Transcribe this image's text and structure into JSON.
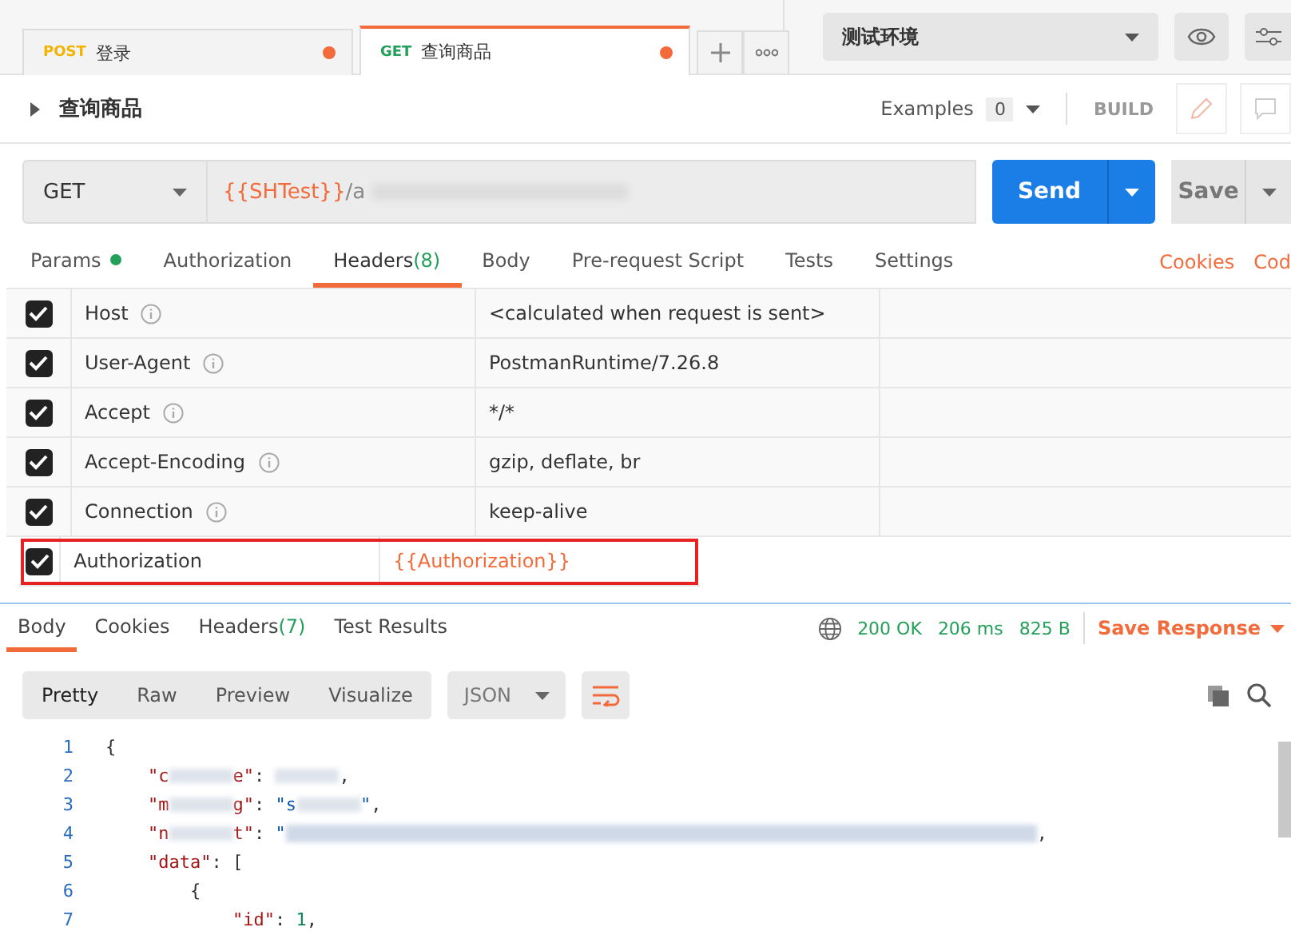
{
  "request_tabs": [
    {
      "method": "POST",
      "name": "登录",
      "selected": false,
      "unsaved": true
    },
    {
      "method": "GET",
      "name": "查询商品",
      "selected": true,
      "unsaved": true
    }
  ],
  "environment": {
    "value": "测试环境"
  },
  "request": {
    "title": "查询商品",
    "examples_label": "Examples",
    "examples_count": "0",
    "build_label": "BUILD",
    "method": "GET",
    "url_variable": "{{SHTest}}",
    "url_rest": "/a",
    "send_label": "Send",
    "save_label": "Save"
  },
  "request_tabs_bar": [
    {
      "label": "Params",
      "dot": true,
      "selected": false
    },
    {
      "label": "Authorization",
      "dot": false,
      "selected": false
    },
    {
      "label": "Headers",
      "dot": false,
      "count": "(8)",
      "selected": true
    },
    {
      "label": "Body",
      "dot": false,
      "selected": false
    },
    {
      "label": "Pre-request Script",
      "dot": false,
      "selected": false
    },
    {
      "label": "Tests",
      "dot": false,
      "selected": false
    },
    {
      "label": "Settings",
      "dot": false,
      "selected": false
    }
  ],
  "links": [
    "Cookies",
    "Cod"
  ],
  "headers": [
    {
      "checked": true,
      "key": "Host",
      "info": true,
      "value": "<calculated when request is sent>",
      "variable": false,
      "highlighted": false
    },
    {
      "checked": true,
      "key": "User-Agent",
      "info": true,
      "value": "PostmanRuntime/7.26.8",
      "variable": false,
      "highlighted": false
    },
    {
      "checked": true,
      "key": "Accept",
      "info": true,
      "value": "*/*",
      "variable": false,
      "highlighted": false
    },
    {
      "checked": true,
      "key": "Accept-Encoding",
      "info": true,
      "value": "gzip, deflate, br",
      "variable": false,
      "highlighted": false
    },
    {
      "checked": true,
      "key": "Connection",
      "info": true,
      "value": "keep-alive",
      "variable": false,
      "highlighted": false
    },
    {
      "checked": true,
      "key": "Authorization",
      "info": false,
      "value": "{{Authorization}}",
      "variable": true,
      "highlighted": true
    }
  ],
  "response_tabs": [
    {
      "label": "Body",
      "selected": true
    },
    {
      "label": "Cookies",
      "selected": false
    },
    {
      "label": "Headers",
      "count": "(7)",
      "selected": false
    },
    {
      "label": "Test Results",
      "selected": false
    }
  ],
  "status": {
    "code": "200 OK",
    "time": "206 ms",
    "size": "825 B",
    "save_label": "Save Response"
  },
  "view_modes": [
    {
      "label": "Pretty",
      "selected": true
    },
    {
      "label": "Raw",
      "selected": false
    },
    {
      "label": "Preview",
      "selected": false
    },
    {
      "label": "Visualize",
      "selected": false
    }
  ],
  "format": "JSON",
  "code_lines": [
    {
      "number": "1",
      "segments": [
        {
          "kind": "punct",
          "text": "{"
        }
      ]
    },
    {
      "number": "2",
      "segments": [
        {
          "kind": "key",
          "text": "    \"c"
        },
        {
          "kind": "redacted"
        },
        {
          "kind": "key",
          "text": "e\""
        },
        {
          "kind": "punct",
          "text": ": "
        },
        {
          "kind": "redacted"
        },
        {
          "kind": "punct",
          "text": ","
        }
      ]
    },
    {
      "number": "3",
      "segments": [
        {
          "kind": "key",
          "text": "    \"m"
        },
        {
          "kind": "redacted"
        },
        {
          "kind": "key",
          "text": "g\""
        },
        {
          "kind": "punct",
          "text": ": "
        },
        {
          "kind": "string",
          "text": "\"s"
        },
        {
          "kind": "redacted"
        },
        {
          "kind": "string",
          "text": "\""
        },
        {
          "kind": "punct",
          "text": ","
        }
      ]
    },
    {
      "number": "4",
      "segments": [
        {
          "kind": "key",
          "text": "    \"n"
        },
        {
          "kind": "redacted"
        },
        {
          "kind": "key",
          "text": "t\""
        },
        {
          "kind": "punct",
          "text": ": "
        },
        {
          "kind": "string",
          "text": "\""
        },
        {
          "kind": "redacted-link"
        },
        {
          "kind": "punct",
          "text": ","
        }
      ]
    },
    {
      "number": "5",
      "segments": [
        {
          "kind": "key",
          "text": "    \"data\""
        },
        {
          "kind": "punct",
          "text": ": ["
        }
      ]
    },
    {
      "number": "6",
      "segments": [
        {
          "kind": "punct",
          "text": "        {"
        }
      ]
    },
    {
      "number": "7",
      "segments": [
        {
          "kind": "key",
          "text": "            \"id\""
        },
        {
          "kind": "punct",
          "text": ": "
        },
        {
          "kind": "number",
          "text": "1"
        },
        {
          "kind": "punct",
          "text": ","
        }
      ]
    }
  ]
}
